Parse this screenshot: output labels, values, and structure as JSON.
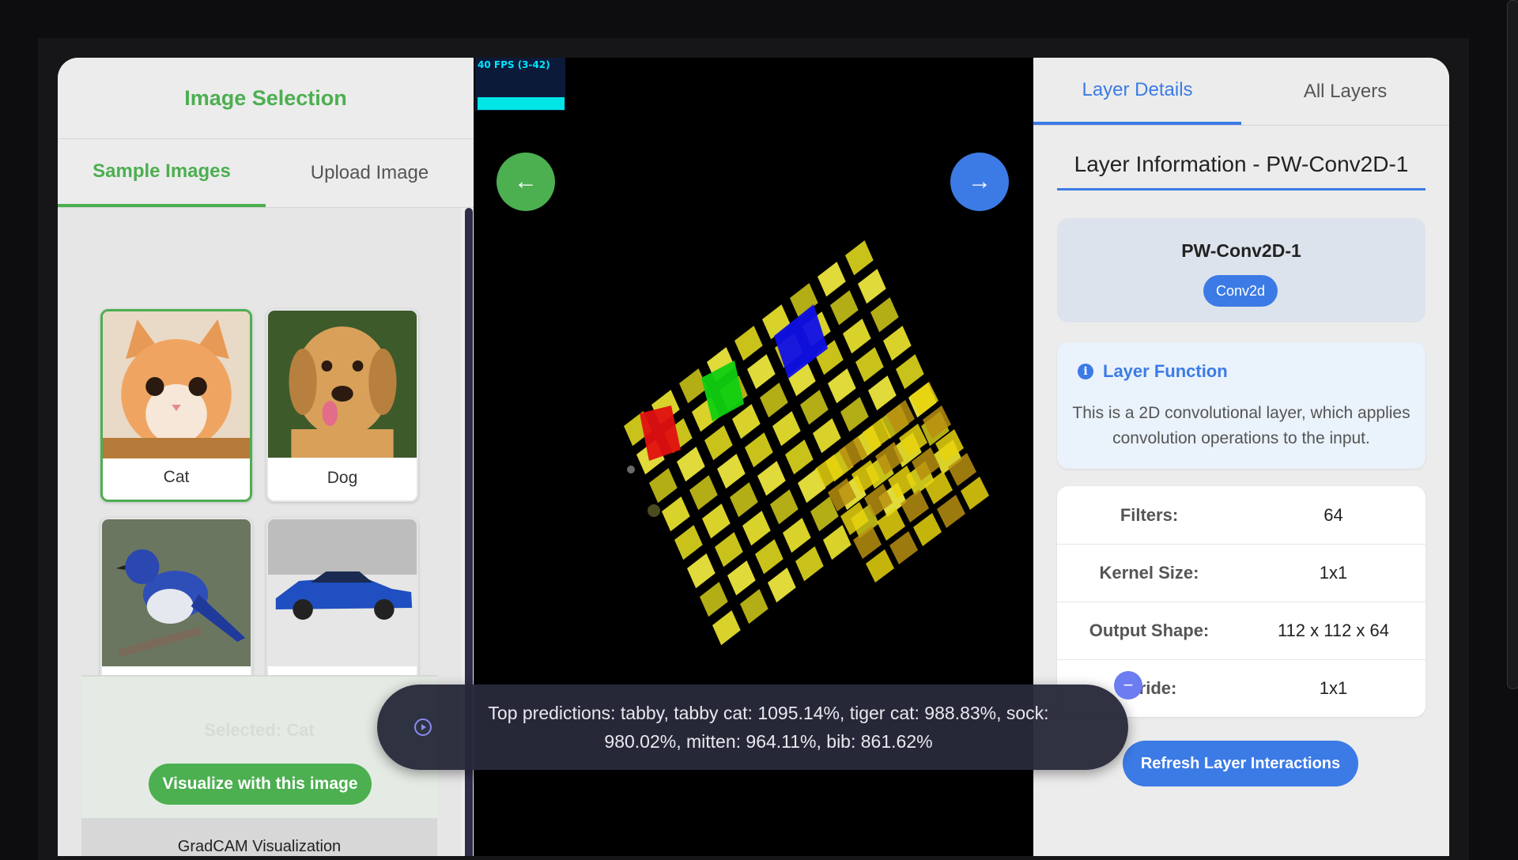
{
  "left_panel": {
    "title": "Image Selection",
    "tabs": [
      {
        "label": "Sample Images",
        "active": true
      },
      {
        "label": "Upload Image",
        "active": false
      }
    ],
    "samples": [
      {
        "label": "Cat",
        "selected": true
      },
      {
        "label": "Dog",
        "selected": false
      },
      {
        "label": "Bird",
        "selected": false
      },
      {
        "label": "Car",
        "selected": false
      }
    ],
    "selected_text": "Selected: Cat",
    "visualize_button": "Visualize with this image",
    "gradcam_title": "GradCAM Visualization"
  },
  "center": {
    "fps_text": "40 FPS (3-42)",
    "prev_icon": "←",
    "next_icon": "→"
  },
  "right_panel": {
    "tabs": [
      {
        "label": "Layer Details",
        "active": true
      },
      {
        "label": "All Layers",
        "active": false
      }
    ],
    "info_title": "Layer Information - PW-Conv2D-1",
    "layer_name": "PW-Conv2D-1",
    "layer_type": "Conv2d",
    "function_heading": "Layer Function",
    "function_text": "This is a 2D convolutional layer, which applies convolution operations to the input.",
    "properties": [
      {
        "key": "Filters:",
        "value": "64"
      },
      {
        "key": "Kernel Size:",
        "value": "1x1"
      },
      {
        "key": "Output Shape:",
        "value": "112 x 112 x 64"
      },
      {
        "key": "Stride:",
        "value": "1x1"
      }
    ],
    "refresh_button": "Refresh Layer Interactions"
  },
  "toast": {
    "text": "Top predictions: tabby, tabby cat: 1095.14%, tiger cat: 988.83%, sock: 980.02%, mitten: 964.11%, bib: 861.62%"
  },
  "colors": {
    "green_accent": "#4caf50",
    "blue_accent": "#3c7be6",
    "canvas_bg": "#000000"
  }
}
